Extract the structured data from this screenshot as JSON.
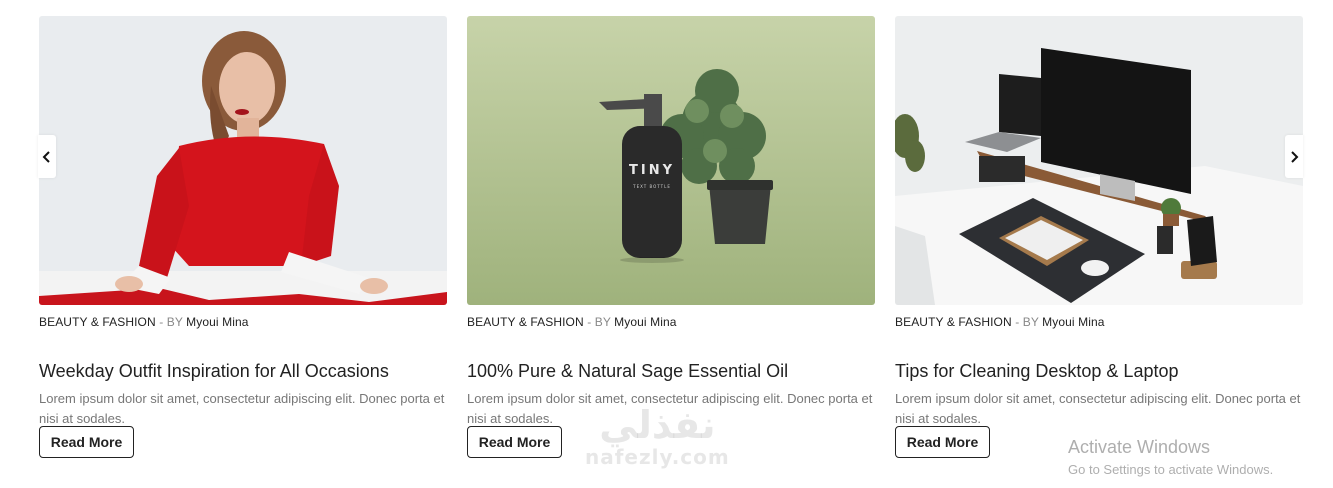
{
  "colors": {
    "text": "#222222",
    "muted": "#777777",
    "meta_sep": "#888888",
    "button_border": "#222222"
  },
  "nav": {
    "prev_icon": "chevron-left-icon",
    "next_icon": "chevron-right-icon"
  },
  "posts": [
    {
      "category": "BEAUTY & FASHION",
      "separator": "-",
      "by": "BY",
      "author": "Myoui Mina",
      "title": "Weekday Outfit Inspiration for All Occasions",
      "excerpt": "Lorem ipsum dolor sit amet, consectetur adipiscing elit. Donec porta et nisi at sodales.",
      "button": "Read More",
      "image": "woman-in-red-sweater-photo"
    },
    {
      "category": "BEAUTY & FASHION",
      "separator": "-",
      "by": "BY",
      "author": "Myoui Mina",
      "title": "100% Pure & Natural Sage Essential Oil",
      "excerpt": "Lorem ipsum dolor sit amet, consectetur adipiscing elit. Donec porta et nisi at sodales.",
      "button": "Read More",
      "image": "oil-bottle-and-plant-photo",
      "bottle_label": "TINY",
      "bottle_sublabel": "TEXT BOTTLE"
    },
    {
      "category": "BEAUTY & FASHION",
      "separator": "-",
      "by": "BY",
      "author": "Myoui Mina",
      "title": "Tips for Cleaning Desktop & Laptop",
      "excerpt": "Lorem ipsum dolor sit amet, consectetur adipiscing elit. Donec porta et nisi at sodales.",
      "button": "Read More",
      "image": "desk-setup-photo"
    }
  ],
  "watermark": {
    "arabic": "نفذلي",
    "latin": "nafezly.com"
  },
  "os_overlay": {
    "line1": "Activate Windows",
    "line2": "Go to Settings to activate Windows."
  }
}
